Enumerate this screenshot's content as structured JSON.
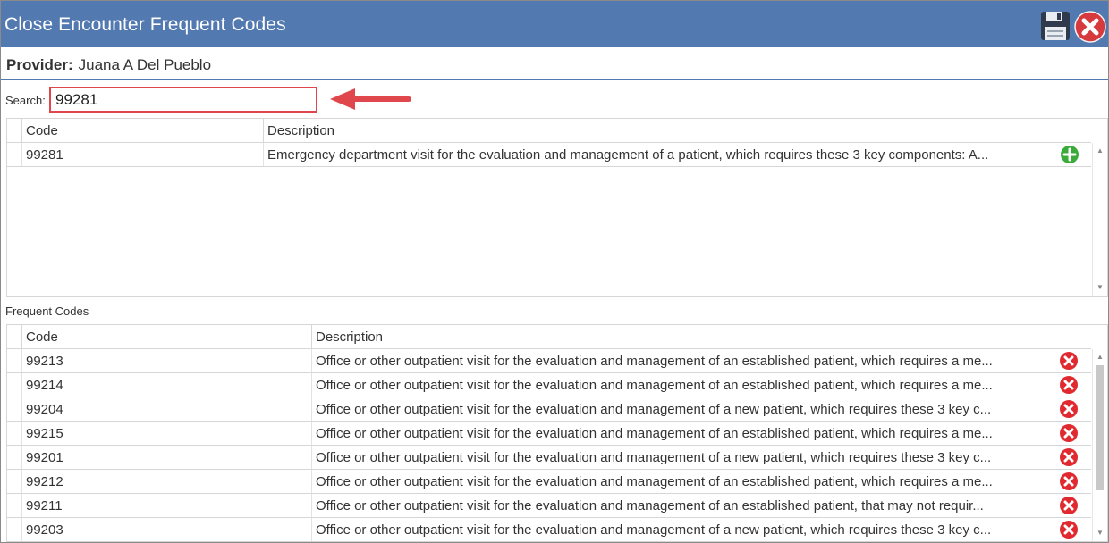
{
  "window": {
    "title": "Close Encounter Frequent Codes",
    "accent": "#5279b0",
    "save_icon": "floppy-disk-icon",
    "close_icon": "red-circle-x-icon"
  },
  "provider": {
    "label": "Provider:",
    "name": "Juana A Del Pueblo"
  },
  "search": {
    "label": "Search:",
    "value": "99281"
  },
  "search_results": {
    "headers": {
      "code": "Code",
      "description": "Description"
    },
    "rows": [
      {
        "code": "99281",
        "description": "Emergency department visit for the evaluation and management of a patient, which requires these 3 key components: A...",
        "action_icon": "green-plus-icon"
      }
    ]
  },
  "frequent_codes": {
    "label": "Frequent Codes",
    "headers": {
      "code": "Code",
      "description": "Description"
    },
    "rows": [
      {
        "code": "99213",
        "description": "Office or other outpatient visit for the evaluation and management of an established patient, which requires a me..."
      },
      {
        "code": "99214",
        "description": "Office or other outpatient visit for the evaluation and management of an established patient, which requires a me..."
      },
      {
        "code": "99204",
        "description": "Office or other outpatient visit for the evaluation and management of a new patient, which requires these 3 key c..."
      },
      {
        "code": "99215",
        "description": "Office or other outpatient visit for the evaluation and management of an established patient, which requires a me..."
      },
      {
        "code": "99201",
        "description": "Office or other outpatient visit for the evaluation and management of a new patient, which requires these 3 key c..."
      },
      {
        "code": "99212",
        "description": "Office or other outpatient visit for the evaluation and management of an established patient, which requires a me..."
      },
      {
        "code": "99211",
        "description": "Office or other outpatient visit for the evaluation and management of an established patient, that may not requir..."
      },
      {
        "code": "99203",
        "description": "Office or other outpatient visit for the evaluation and management of a new patient, which requires these 3 key c..."
      }
    ],
    "row_action_icon": "red-circle-x-icon"
  }
}
